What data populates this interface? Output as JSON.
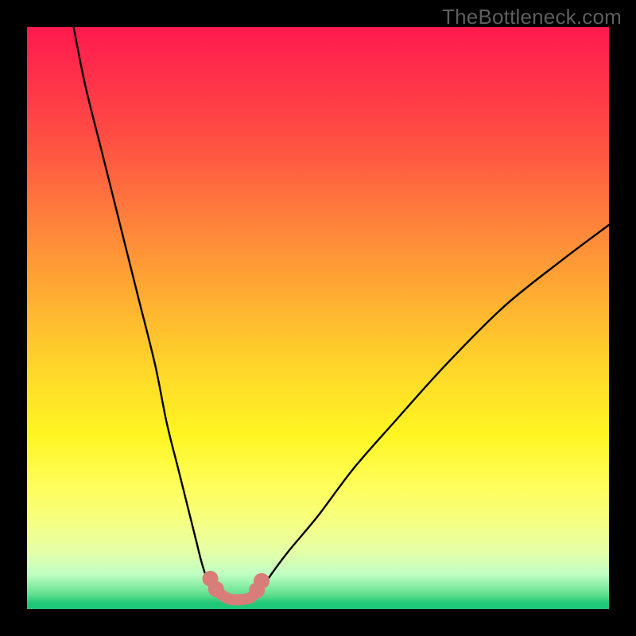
{
  "watermark": "TheBottleneck.com",
  "chart_data": {
    "type": "line",
    "title": "",
    "xlabel": "",
    "ylabel": "",
    "xlim": [
      0,
      100
    ],
    "ylim": [
      0,
      100
    ],
    "series": [
      {
        "name": "left-branch",
        "x": [
          8,
          10,
          13,
          16,
          19,
          22,
          24,
          26,
          27.5,
          29,
          30,
          31,
          32
        ],
        "y": [
          100,
          90,
          78,
          66,
          54,
          42,
          32,
          24,
          18,
          12,
          8,
          5,
          3
        ]
      },
      {
        "name": "right-branch",
        "x": [
          40,
          42,
          45,
          50,
          56,
          63,
          72,
          82,
          92,
          100
        ],
        "y": [
          3,
          6,
          10,
          16,
          24,
          32,
          42,
          52,
          60,
          66
        ]
      },
      {
        "name": "valley-highlight",
        "x": [
          31.5,
          32.5,
          33.5,
          34.5,
          35.5,
          36.5,
          37.5,
          38.5,
          39.5,
          40.3
        ],
        "y": [
          5.2,
          3.4,
          2.4,
          1.8,
          1.6,
          1.6,
          1.7,
          2.0,
          3.2,
          4.8
        ]
      }
    ],
    "annotations": [],
    "legend": null,
    "grid": false,
    "notes": "Y-axis values are percentage bottleneck (0 = no bottleneck at bottom, 100 = severe at top). Numbers are estimated from curve shape; axes are not labeled in the source image."
  },
  "colors": {
    "curve": "#000000",
    "highlight": "#d97d7a"
  }
}
